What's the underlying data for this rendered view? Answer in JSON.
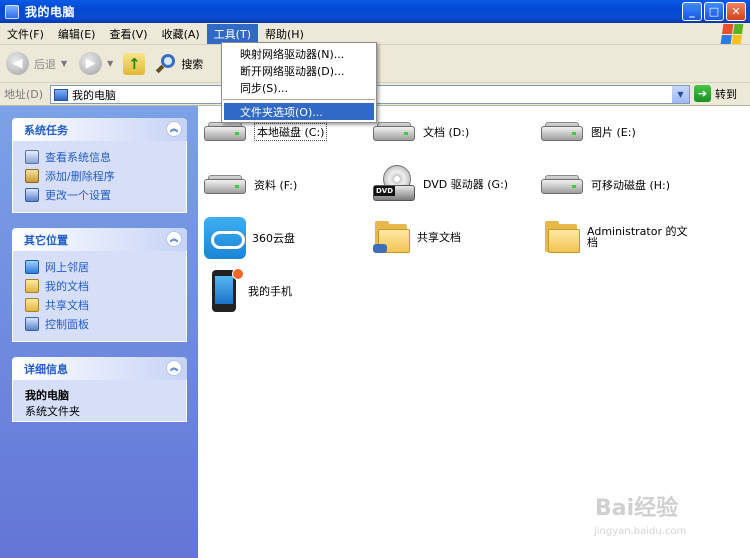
{
  "window": {
    "title": "我的电脑"
  },
  "menubar": {
    "items": [
      "文件(F)",
      "编辑(E)",
      "查看(V)",
      "收藏(A)",
      "工具(T)",
      "帮助(H)"
    ]
  },
  "toolbar": {
    "back_label": "后退",
    "search_label": "搜索"
  },
  "address": {
    "label": "地址(D)",
    "value": "我的电脑",
    "go_label": "转到"
  },
  "tools_menu": {
    "items": [
      "映射网络驱动器(N)...",
      "断开网络驱动器(D)...",
      "同步(S)...",
      "文件夹选项(O)..."
    ]
  },
  "sidebar": {
    "system_tasks": {
      "title": "系统任务",
      "items": [
        "查看系统信息",
        "添加/删除程序",
        "更改一个设置"
      ]
    },
    "other_places": {
      "title": "其它位置",
      "items": [
        "网上邻居",
        "我的文档",
        "共享文档",
        "控制面板"
      ]
    },
    "details": {
      "title": "详细信息",
      "name": "我的电脑",
      "type": "系统文件夹"
    }
  },
  "items": [
    "本地磁盘 (C:)",
    "文档 (D:)",
    "图片 (E:)",
    "资料 (F:)",
    "DVD 驱动器 (G:)",
    "可移动磁盘 (H:)",
    "360云盘",
    "共享文档",
    "Administrator 的文档",
    "我的手机"
  ],
  "watermark": {
    "text": "Bai经验",
    "sub": "jingyan.baidu.com"
  }
}
